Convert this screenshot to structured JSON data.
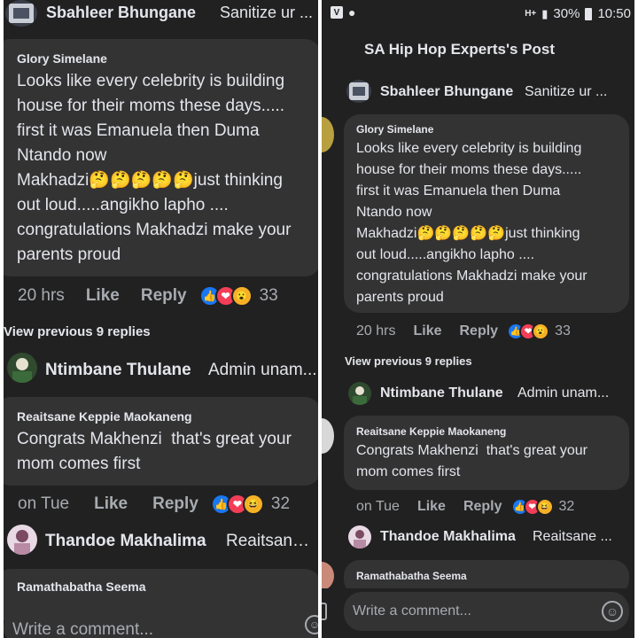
{
  "left": {
    "top_comment": {
      "author": "Sbahleer Bhungane",
      "snippet": "Sanitize ur ..."
    },
    "comment1": {
      "author": "Glory Simelane",
      "text": "Looks like every celebrity is building\nhouse for their moms these days.....\nfirst it was Emanuela then Duma\nNtando now\nMakhadzi🤔🤔🤔🤔🤔just thinking\nout loud.....angikho lapho ....\ncongratulations Makhadzi make your\nparents proud",
      "time": "20 hrs",
      "like": "Like",
      "reply": "Reply",
      "reaction_count": "33"
    },
    "view_previous": "View previous 9 replies",
    "reply1": {
      "author": "Ntimbane Thulane",
      "snippet": "Admin unam..."
    },
    "comment2": {
      "author": "Reaitsane Keppie Maokaneng",
      "text": "Congrats Makhenzi  that's great your\nmom comes first",
      "time": "on Tue",
      "like": "Like",
      "reply": "Reply",
      "reaction_count": "32"
    },
    "reply2": {
      "author": "Thandoe Makhalima",
      "snippet": "Reaitsane ..."
    },
    "comment3": {
      "author": "Ramathabatha Seema"
    },
    "composer_placeholder": "Write a comment..."
  },
  "right": {
    "status_bar": {
      "signal": "H+",
      "battery": "30%",
      "time": "10:50"
    },
    "post_title": "SA Hip Hop Experts's Post",
    "top_comment": {
      "author": "Sbahleer Bhungane",
      "snippet": "Sanitize ur ..."
    },
    "comment1": {
      "author": "Glory Simelane",
      "text": "Looks like every celebrity is building\nhouse for their moms these days.....\nfirst it was Emanuela then Duma\nNtando now\nMakhadzi🤔🤔🤔🤔🤔just thinking\nout loud.....angikho lapho ....\ncongratulations Makhadzi make your\nparents proud",
      "time": "20 hrs",
      "like": "Like",
      "reply": "Reply",
      "reaction_count": "33"
    },
    "view_previous": "View previous 9 replies",
    "reply1": {
      "author": "Ntimbane Thulane",
      "snippet": "Admin unam..."
    },
    "comment2": {
      "author": "Reaitsane Keppie Maokaneng",
      "text": "Congrats Makhenzi  that's great your\nmom comes first",
      "time": "on Tue",
      "like": "Like",
      "reply": "Reply",
      "reaction_count": "32"
    },
    "reply2": {
      "author": "Thandoe Makhalima",
      "snippet": "Reaitsane ..."
    },
    "comment3": {
      "author": "Ramathabatha Seema"
    },
    "composer_placeholder": "Write a comment..."
  },
  "colors": {
    "background": "#212121",
    "bubble": "#333334",
    "text": "#e4e6eb",
    "meta": "#a8abb0",
    "like": "#1877f2",
    "love": "#f33e58",
    "wow": "#f7b125"
  },
  "icons": {
    "reactions": [
      "like-reaction-icon",
      "love-reaction-icon",
      "wow-reaction-icon"
    ],
    "composer": "smiley-icon",
    "status": [
      "wifi-icon",
      "signal-icon",
      "battery-icon"
    ]
  }
}
